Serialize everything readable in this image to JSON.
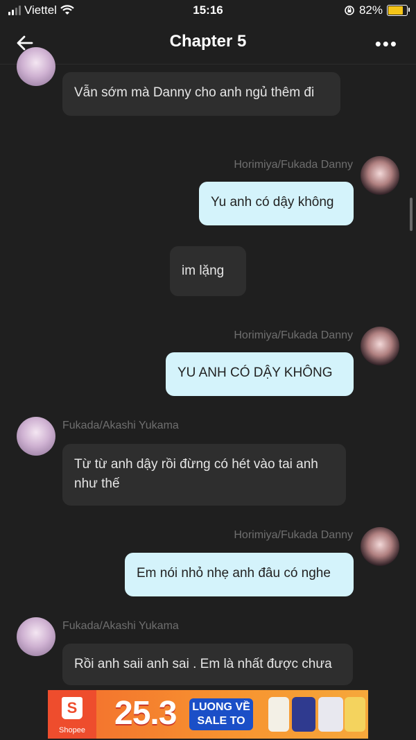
{
  "status_bar": {
    "carrier": "Viettel",
    "time": "15:16",
    "battery": "82%"
  },
  "header": {
    "title": "Chapter 5"
  },
  "messages": [
    {
      "side": "left",
      "sender": "",
      "text": "Vẫn sớm mà Danny cho anh ngủ thêm đi"
    },
    {
      "side": "right",
      "sender": "Horimiya/Fukada Danny",
      "text": "Yu anh có dậy không"
    },
    {
      "side": "narration",
      "sender": "",
      "text": "im lặng"
    },
    {
      "side": "right",
      "sender": "Horimiya/Fukada Danny",
      "text": "YU ANH CÓ DẬY KHÔNG"
    },
    {
      "side": "left",
      "sender": "Fukada/Akashi Yukama",
      "text": "Từ từ anh dậy rồi đừng có hét vào tai anh như thế"
    },
    {
      "side": "right",
      "sender": "Horimiya/Fukada Danny",
      "text": "Em nói nhỏ nhẹ anh đâu có nghe"
    },
    {
      "side": "left",
      "sender": "Fukada/Akashi Yukama",
      "text": "Rồi anh saii anh sai . Em là nhất được chưa"
    }
  ],
  "ad": {
    "brand": "Shopee",
    "date": "25.3",
    "tag_line1": "LUONG VỀ",
    "tag_line2": "SALE TO"
  }
}
